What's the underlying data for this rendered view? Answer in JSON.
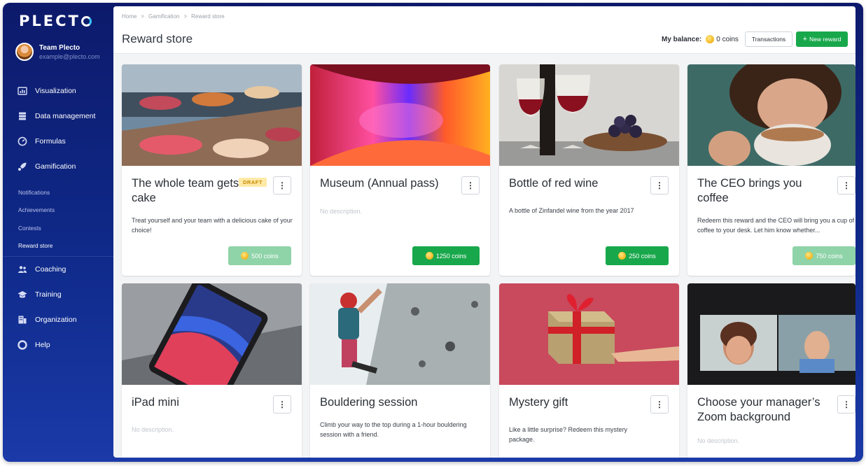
{
  "brand": {
    "logo_text": "PLECT",
    "accent": "#18a84b"
  },
  "user": {
    "name": "Team Plecto",
    "email": "example@plecto.com"
  },
  "nav": {
    "visualization": "Visualization",
    "data_management": "Data management",
    "formulas": "Formulas",
    "gamification": "Gamification",
    "sub": [
      "Notifications",
      "Achievements",
      "Contests",
      "Reward store"
    ],
    "coaching": "Coaching",
    "training": "Training",
    "organization": "Organization",
    "help": "Help"
  },
  "breadcrumb": [
    "Home",
    "Gamification",
    "Reward store"
  ],
  "page_title": "Reward store",
  "balance": {
    "label": "My balance:",
    "value": "0 coins"
  },
  "buttons": {
    "transactions": "Transactions",
    "new_reward": "New reward"
  },
  "cards": [
    {
      "title": "The whole team gets cake",
      "badge": "DRAFT",
      "description": "Treat yourself and your team with a delicious cake of your choice!",
      "price": "500 coins"
    },
    {
      "title": "Museum (Annual pass)",
      "description": "No description.",
      "price": "1250 coins"
    },
    {
      "title": "Bottle of red wine",
      "description": "A bottle of Zinfandel wine from the year 2017",
      "price": "250 coins"
    },
    {
      "title": "The CEO brings you coffee",
      "description": "Redeem this reward and the CEO will bring you a cup of coffee to your desk. Let him know whether...",
      "price": "750 coins"
    },
    {
      "title": "iPad mini",
      "description": "No description."
    },
    {
      "title": "Bouldering session",
      "description": "Climb your way to the top during a 1-hour bouldering session with a friend."
    },
    {
      "title": "Mystery gift",
      "description": "Like a little surprise? Redeem this mystery package."
    },
    {
      "title": "Choose your manager’s Zoom background",
      "description": "No description."
    }
  ]
}
